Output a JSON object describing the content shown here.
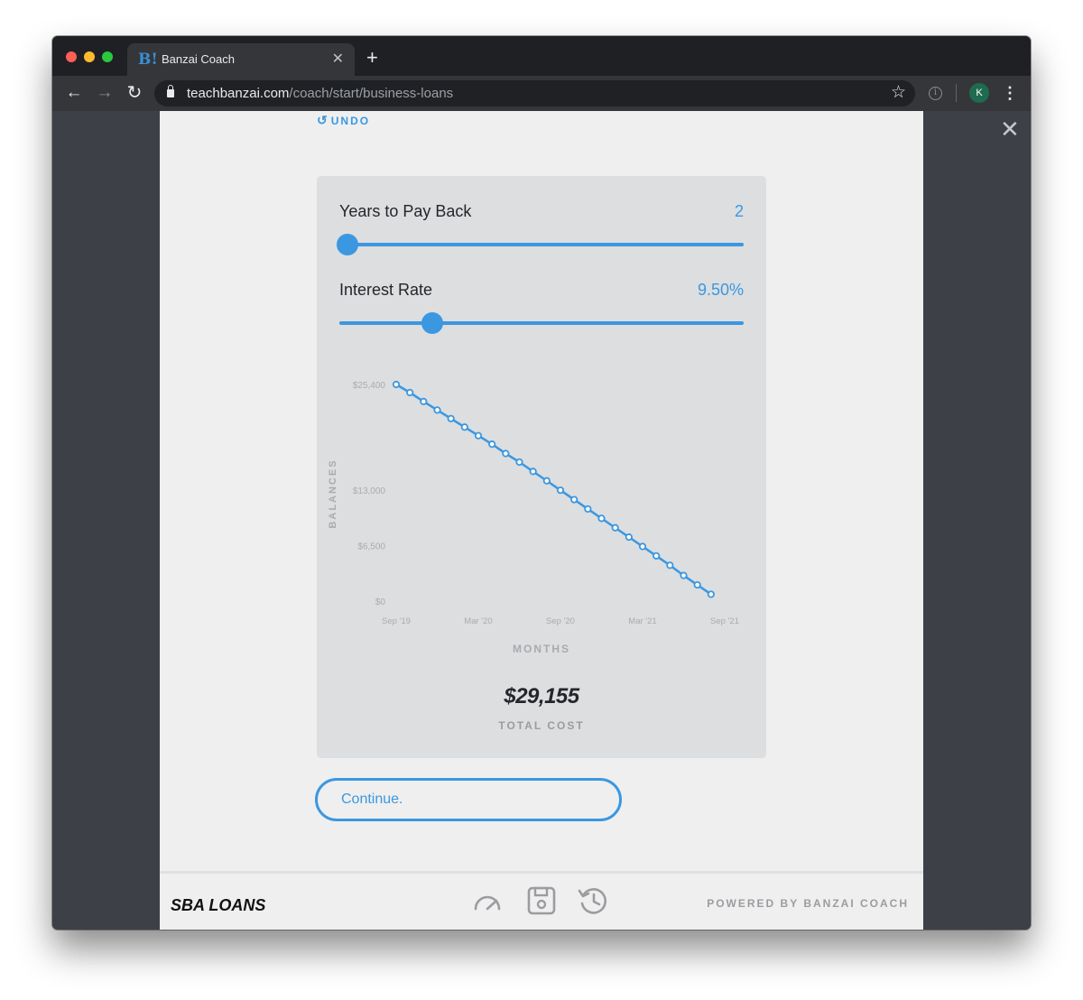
{
  "browser": {
    "tab_title": "Banzai Coach",
    "tab_favicon": "B!",
    "url_host": "teachbanzai.com",
    "url_path": "/coach/start/business-loans",
    "profile_initial": "K"
  },
  "page": {
    "undo_label": "UNDO",
    "params": [
      {
        "label": "Years to Pay Back",
        "value": "2",
        "slider_fraction": 0.02
      },
      {
        "label": "Interest Rate",
        "value": "9.50%",
        "slider_fraction": 0.23
      }
    ],
    "total_cost": "$29,155",
    "total_cost_label": "TOTAL COST",
    "continue_label": "Continue."
  },
  "footer": {
    "brand": "SBA LOANS",
    "powered_by": "POWERED BY BANZAI COACH",
    "icons": [
      "speedometer-icon",
      "save-icon",
      "history-icon"
    ]
  },
  "chart_data": {
    "type": "line",
    "xlabel": "MONTHS",
    "ylabel": "BALANCES",
    "y_ticks": [
      {
        "label": "$25,400",
        "value": 25400
      },
      {
        "label": "$13,000",
        "value": 13000
      },
      {
        "label": "$6,500",
        "value": 6500
      },
      {
        "label": "$0",
        "value": 0
      }
    ],
    "x_ticks": [
      {
        "label": "Sep '19",
        "index": 0
      },
      {
        "label": "Mar '20",
        "index": 6
      },
      {
        "label": "Sep '20",
        "index": 12
      },
      {
        "label": "Mar '21",
        "index": 18
      },
      {
        "label": "Sep '21",
        "index": 24
      }
    ],
    "ylim": [
      0,
      25400
    ],
    "x_range": [
      0,
      24
    ],
    "grid": false,
    "accent": "#3b97e0",
    "series": [
      {
        "x": [
          0,
          1,
          2,
          3,
          4,
          5,
          6,
          7,
          8,
          9,
          10,
          11,
          12,
          13,
          14,
          15,
          16,
          17,
          18,
          19,
          20,
          21,
          22,
          23
        ],
        "values": [
          25400,
          24450,
          23400,
          22400,
          21400,
          20400,
          19400,
          18400,
          17300,
          16300,
          15200,
          14100,
          13000,
          11900,
          10800,
          9700,
          8600,
          7500,
          6400,
          5300,
          4200,
          3000,
          1900,
          800
        ]
      }
    ]
  }
}
